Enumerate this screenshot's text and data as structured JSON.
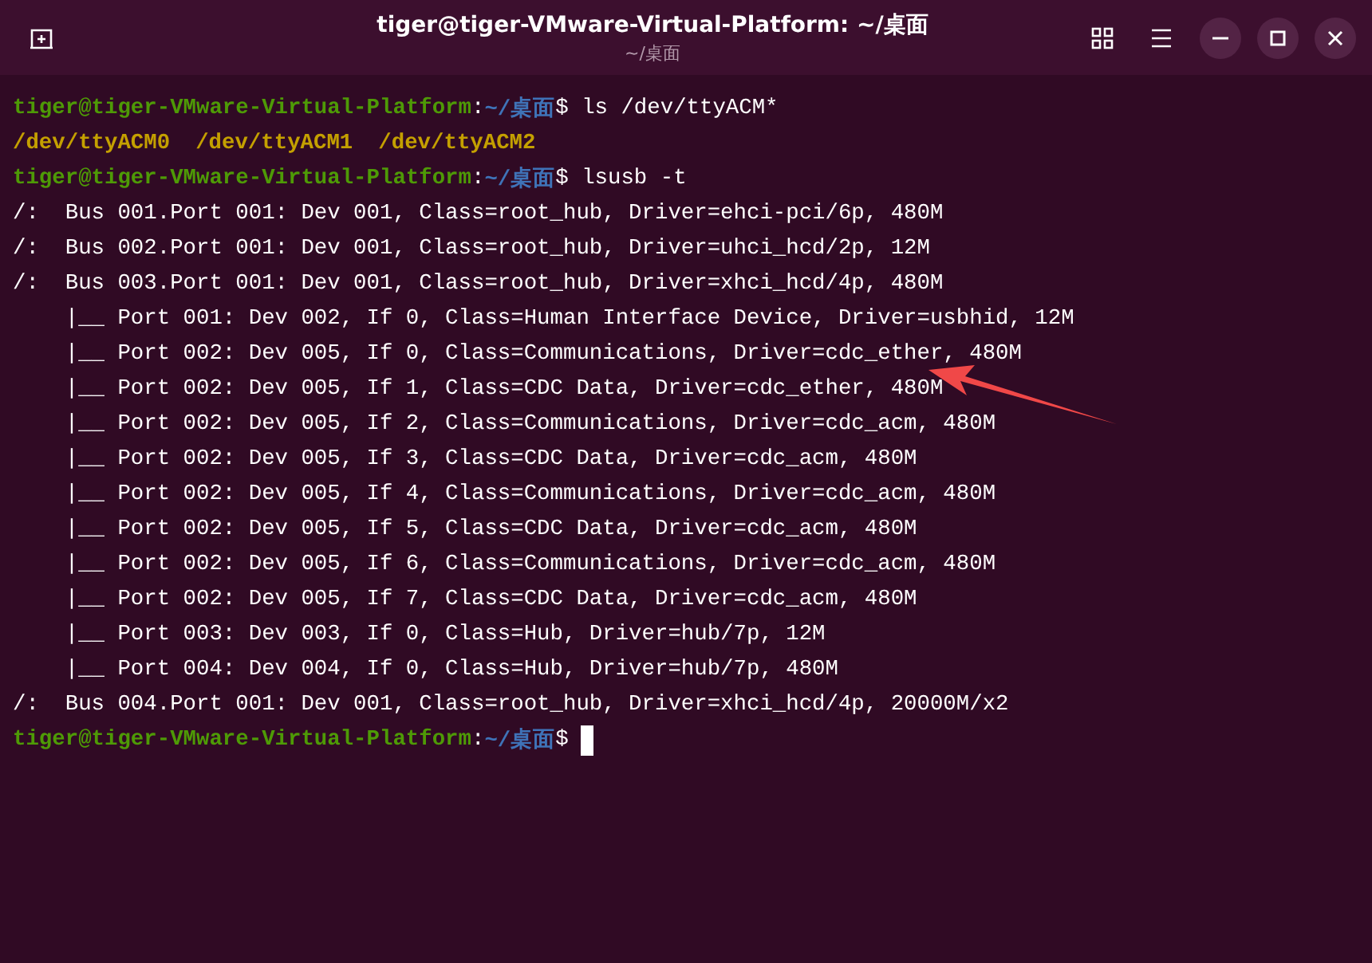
{
  "window": {
    "title": "tiger@tiger-VMware-Virtual-Platform: ~/桌面",
    "subtitle": "~/桌面"
  },
  "terminal": {
    "lines": [
      {
        "kind": "prompt",
        "user": "tiger@tiger-VMware-Virtual-Platform",
        "separator": ":",
        "path": "~/桌面",
        "command": "$ ls /dev/ttyACM*"
      },
      {
        "kind": "files",
        "items": [
          "/dev/ttyACM0",
          "/dev/ttyACM1",
          "/dev/ttyACM2"
        ]
      },
      {
        "kind": "prompt",
        "user": "tiger@tiger-VMware-Virtual-Platform",
        "separator": ":",
        "path": "~/桌面",
        "command": "$ lsusb -t"
      },
      {
        "kind": "output",
        "text": "/:  Bus 001.Port 001: Dev 001, Class=root_hub, Driver=ehci-pci/6p, 480M"
      },
      {
        "kind": "output",
        "text": "/:  Bus 002.Port 001: Dev 001, Class=root_hub, Driver=uhci_hcd/2p, 12M"
      },
      {
        "kind": "output",
        "text": "/:  Bus 003.Port 001: Dev 001, Class=root_hub, Driver=xhci_hcd/4p, 480M"
      },
      {
        "kind": "output",
        "text": "    |__ Port 001: Dev 002, If 0, Class=Human Interface Device, Driver=usbhid, 12M"
      },
      {
        "kind": "output",
        "text": "    |__ Port 002: Dev 005, If 0, Class=Communications, Driver=cdc_ether, 480M"
      },
      {
        "kind": "output",
        "text": "    |__ Port 002: Dev 005, If 1, Class=CDC Data, Driver=cdc_ether, 480M"
      },
      {
        "kind": "output",
        "text": "    |__ Port 002: Dev 005, If 2, Class=Communications, Driver=cdc_acm, 480M"
      },
      {
        "kind": "output",
        "text": "    |__ Port 002: Dev 005, If 3, Class=CDC Data, Driver=cdc_acm, 480M"
      },
      {
        "kind": "output",
        "text": "    |__ Port 002: Dev 005, If 4, Class=Communications, Driver=cdc_acm, 480M"
      },
      {
        "kind": "output",
        "text": "    |__ Port 002: Dev 005, If 5, Class=CDC Data, Driver=cdc_acm, 480M"
      },
      {
        "kind": "output",
        "text": "    |__ Port 002: Dev 005, If 6, Class=Communications, Driver=cdc_acm, 480M"
      },
      {
        "kind": "output",
        "text": "    |__ Port 002: Dev 005, If 7, Class=CDC Data, Driver=cdc_acm, 480M"
      },
      {
        "kind": "output",
        "text": "    |__ Port 003: Dev 003, If 0, Class=Hub, Driver=hub/7p, 12M"
      },
      {
        "kind": "output",
        "text": "    |__ Port 004: Dev 004, If 0, Class=Hub, Driver=hub/7p, 480M"
      },
      {
        "kind": "output",
        "text": "/:  Bus 004.Port 001: Dev 001, Class=root_hub, Driver=xhci_hcd/4p, 20000M/x2"
      },
      {
        "kind": "prompt",
        "user": "tiger@tiger-VMware-Virtual-Platform",
        "separator": ":",
        "path": "~/桌面",
        "command": "$",
        "cursor": true
      }
    ]
  }
}
